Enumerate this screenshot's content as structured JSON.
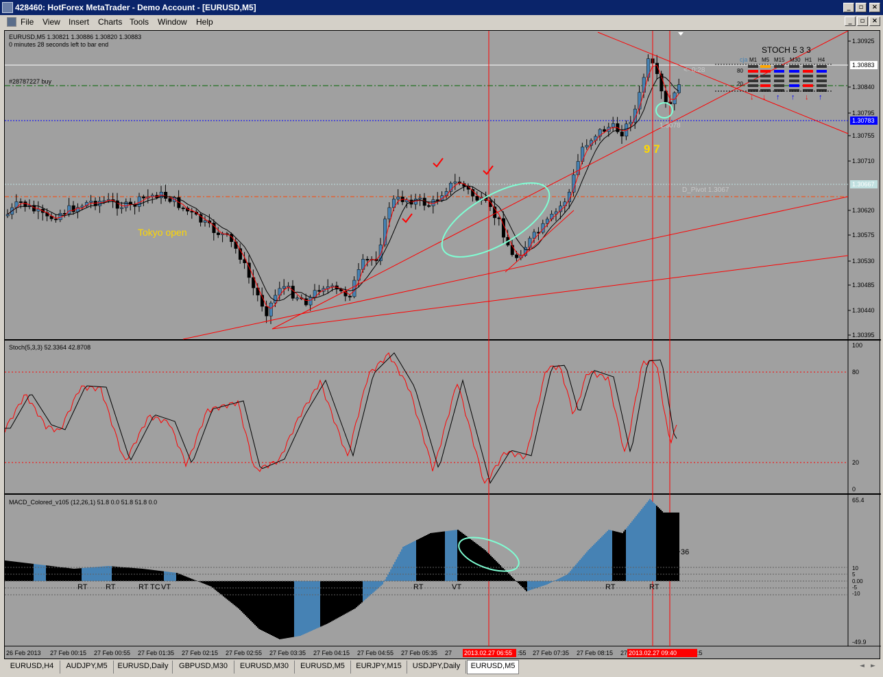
{
  "window": {
    "title": "428460: HotForex MetaTrader - Demo Account - [EURUSD,M5]",
    "controls": [
      "_",
      "▫",
      "×"
    ]
  },
  "menu": [
    "File",
    "View",
    "Insert",
    "Charts",
    "Tools",
    "Window",
    "Help"
  ],
  "chart": {
    "header_line1": "EURUSD,M5  1.30821 1.30886 1.30820 1.30883",
    "header_line2": "0 minutes 28 seconds left to bar end",
    "order_label": "#28787227 buy",
    "tokyo_label": "Tokyo open",
    "timer_label": "<- 0:28",
    "price_marker": "1.3078",
    "pivot_label": "D_Pivot 1.3067",
    "count_label": "9 7",
    "current_price": "1.30883",
    "blue_price": "1.30783",
    "pivot_price": "1.30667",
    "price_ticks": [
      "1.30925",
      "1.30883",
      "1.30840",
      "1.30795",
      "1.30755",
      "1.30710",
      "1.30667",
      "1.30620",
      "1.30575",
      "1.30530",
      "1.30485",
      "1.30440",
      "1.30395"
    ],
    "stoch_panel": {
      "title": "STOCH  5 3 3",
      "prefix": "cja",
      "timeframes": [
        "M1",
        "M5",
        "M15",
        "M30",
        "H1",
        "H4"
      ],
      "levels": [
        "80",
        "20"
      ]
    }
  },
  "stoch": {
    "label": "Stoch(5,3,3) 52.3364 42.8708",
    "scale": [
      "100",
      "80",
      "20",
      "0"
    ]
  },
  "macd": {
    "label": "MACD_Colored_v105 (12,26,1) 51.8 0.0 51.8 51.8 0.0",
    "scale": [
      "65.4",
      "10",
      "5",
      "0.00",
      "-5",
      "-10",
      "-49.9"
    ],
    "value_marker": "36",
    "markers": [
      "RT",
      "RT",
      "RT",
      "TC",
      "VT",
      "RT",
      "VT",
      "RT",
      "RT"
    ]
  },
  "time_axis": [
    "26 Feb 2013",
    "27 Feb 00:15",
    "27 Feb 00:55",
    "27 Feb 01:35",
    "27 Feb 02:15",
    "27 Feb 02:55",
    "27 Feb 03:35",
    "27 Feb 04:15",
    "27 Feb 04:55",
    "27 Feb 05:35",
    "27",
    "2013.02.27 06:55",
    ":55",
    "27 Feb 07:35",
    "27 Feb 08:15",
    "27",
    "2013.02.27 09:40",
    ":5"
  ],
  "tabs": [
    "EURUSD,H4",
    "AUDJPY,M5",
    "EURUSD,Daily",
    "GBPUSD,M30",
    "EURUSD,M30",
    "EURUSD,M5",
    "EURJPY,M15",
    "USDJPY,Daily",
    "EURUSD,M5"
  ],
  "colors": {
    "chart_bg": "#a0a0a0",
    "bull": "#4682b4",
    "bear": "#000000",
    "red_line": "#ff0000",
    "highlight": "#7fffd4",
    "title_bar": "#0a246a"
  }
}
